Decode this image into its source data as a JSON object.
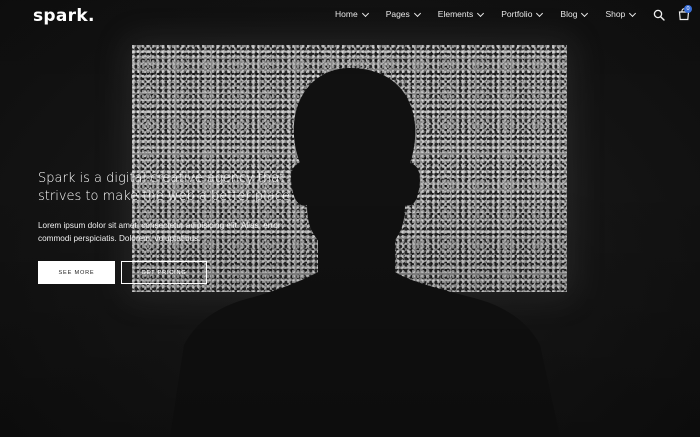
{
  "header": {
    "logo": "spark.",
    "nav": [
      {
        "label": "Home"
      },
      {
        "label": "Pages"
      },
      {
        "label": "Elements"
      },
      {
        "label": "Portfolio"
      },
      {
        "label": "Blog"
      },
      {
        "label": "Shop"
      }
    ],
    "search_icon": "search-icon",
    "cart_icon": "shopping-bag-icon",
    "cart_count": "0"
  },
  "hero": {
    "title_line1": "Spark is a digital creative agency that",
    "title_line2": "strives to make the web a better place",
    "description": "Lorem ipsum dolor sit amet, consectetur adipisicing elit. Alias, error commodi perspiciatis. Dolorem, voluptatibus.",
    "primary_button": "SEE MORE",
    "secondary_button": "GET PRICING"
  },
  "colors": {
    "background": "#151515",
    "text": "#ffffff",
    "accent_badge": "#3a6fd8"
  }
}
